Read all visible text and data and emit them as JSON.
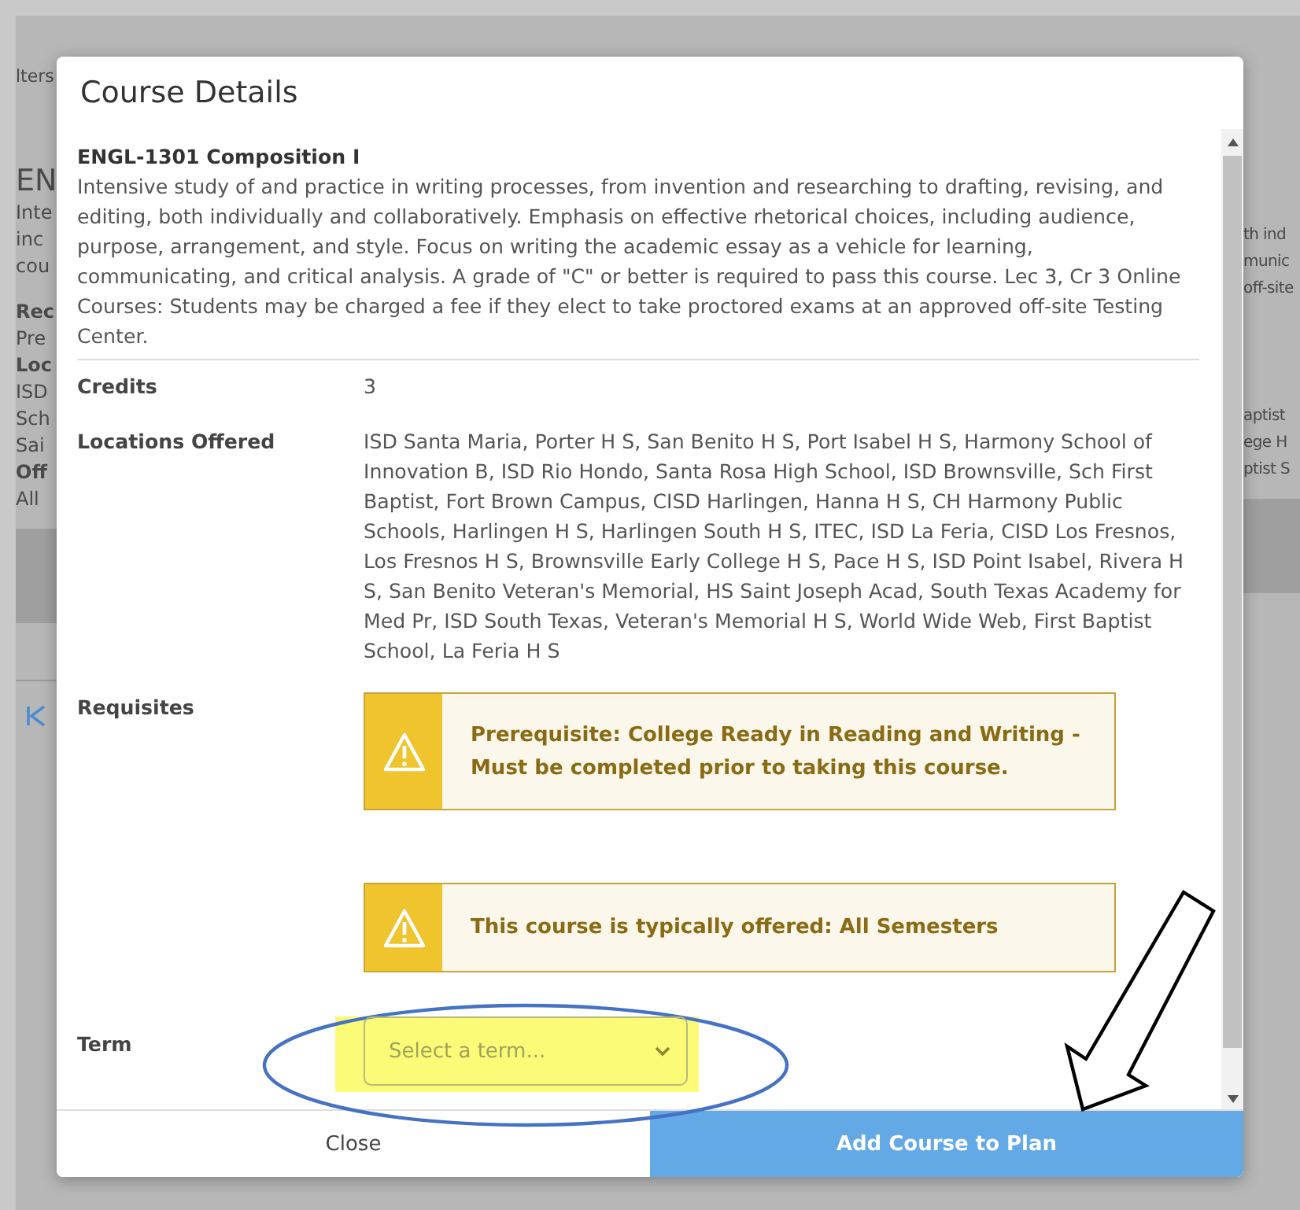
{
  "background": {
    "left": {
      "filter_label": "lters",
      "title": "EN",
      "intro": [
        "Inte",
        "inc",
        "cou"
      ],
      "details": [
        {
          "text": "Rec",
          "kind": "bold"
        },
        {
          "text": "Pre",
          "kind": "text"
        },
        {
          "text": "Loc",
          "kind": "bold"
        },
        {
          "text": "ISD",
          "kind": "text"
        },
        {
          "text": "Sch",
          "kind": "text"
        },
        {
          "text": "Sai",
          "kind": "text"
        },
        {
          "text": "Off",
          "kind": "bold"
        },
        {
          "text": "All",
          "kind": "text"
        }
      ]
    },
    "right": {
      "intro": [
        "th ind",
        "munic",
        "off-site"
      ],
      "details": [
        "aptist",
        "ege H",
        "ptist S"
      ]
    }
  },
  "modal": {
    "title": "Course Details",
    "course_title": "ENGL-1301 Composition I",
    "description": "Intensive study of and practice in writing processes, from invention and researching to drafting, revising, and editing, both individually and collaboratively. Emphasis on effective rhetorical choices, including audience, purpose, arrangement, and style. Focus on writing the academic essay as a vehicle for learning, communicating, and critical analysis. A grade of \"C\" or better is required to pass this course. Lec 3, Cr 3 Online Courses: Students may be charged a fee if they elect to take proctored exams at an approved off-site Testing Center.",
    "credits": {
      "label": "Credits",
      "value": "3"
    },
    "locations": {
      "label": "Locations Offered",
      "value": "ISD Santa Maria, Porter H S, San Benito H S, Port Isabel H S, Harmony School of Innovation B, ISD Rio Hondo, Santa Rosa High School, ISD Brownsville, Sch First Baptist, Fort Brown Campus, CISD Harlingen, Hanna H S, CH Harmony Public Schools, Harlingen H S, Harlingen South H S, ITEC, ISD La Feria, CISD Los Fresnos, Los Fresnos H S, Brownsville Early College H S, Pace H S, ISD Point Isabel, Rivera H S, San Benito Veteran's Memorial, HS Saint Joseph Acad, South Texas Academy for Med Pr, ISD South Texas, Veteran's Memorial H S, World Wide Web, First Baptist School, La Feria H S"
    },
    "requisites": {
      "label": "Requisites",
      "notices": [
        {
          "text": "Prerequisite: College Ready in Reading and Writing - Must be completed prior to taking this course."
        },
        {
          "text": "This course is typically offered: All Semesters"
        }
      ]
    },
    "term": {
      "label": "Term",
      "placeholder": "Select a term...",
      "highlighted": true
    },
    "buttons": [
      {
        "label": "Close",
        "kind": "secondary"
      },
      {
        "label": "Add Course to Plan",
        "kind": "primary"
      }
    ]
  }
}
